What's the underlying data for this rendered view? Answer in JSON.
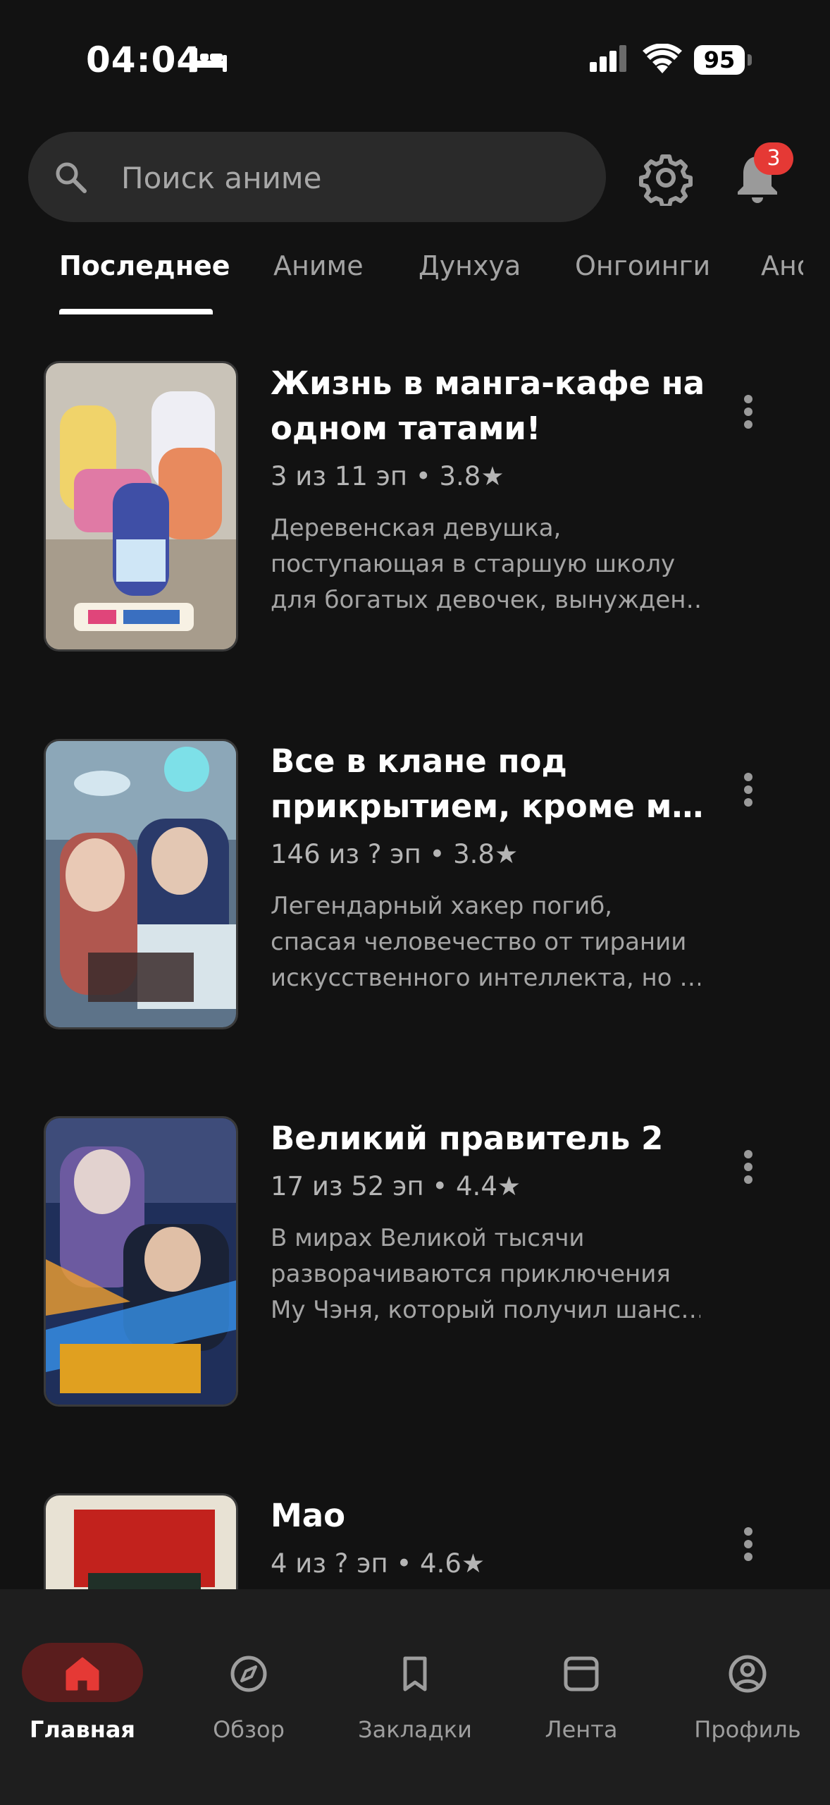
{
  "status_bar": {
    "time": "04:04",
    "battery": "95"
  },
  "search": {
    "placeholder": "Поиск аниме"
  },
  "notifications": {
    "count": "3"
  },
  "tabs": [
    {
      "label": "Последнее"
    },
    {
      "label": "Аниме"
    },
    {
      "label": "Дунхуа"
    },
    {
      "label": "Онгоинги"
    },
    {
      "label": "Ано"
    }
  ],
  "items": [
    {
      "title_line1": "Жизнь в манга-кафе на",
      "title_line2": "одном татами!",
      "meta": "3 из 11 эп • 3.8★",
      "desc1": "Деревенская девушка,",
      "desc2": "поступающая в старшую школу",
      "desc3": "для богатых девочек, вынужден…"
    },
    {
      "title_line1": "Все в клане под",
      "title_line2": "прикрытием, кроме м…",
      "meta": "146 из ? эп • 3.8★",
      "desc1": "Легендарный хакер погиб,",
      "desc2": "спасая человечество от тирании",
      "desc3": "искусственного интеллекта, но …"
    },
    {
      "title_line1": "Великий правитель 2",
      "meta": "17 из 52 эп • 4.4★",
      "desc1": "В мирах Великой тысячи",
      "desc2": "разворачиваются приключения",
      "desc3": "Му Чэня, который получил шанс…"
    },
    {
      "title_line1": "Мао",
      "meta": "4 из ? эп • 4.6★"
    }
  ],
  "bottom_nav": [
    {
      "label": "Главная",
      "icon": "home-icon"
    },
    {
      "label": "Обзор",
      "icon": "compass-icon"
    },
    {
      "label": "Закладки",
      "icon": "bookmark-icon"
    },
    {
      "label": "Лента",
      "icon": "feed-icon"
    },
    {
      "label": "Профиль",
      "icon": "profile-icon"
    }
  ],
  "colors": {
    "accent": "#e53935",
    "background": "#121212",
    "nav_active_pill": "#5a1d1d"
  }
}
